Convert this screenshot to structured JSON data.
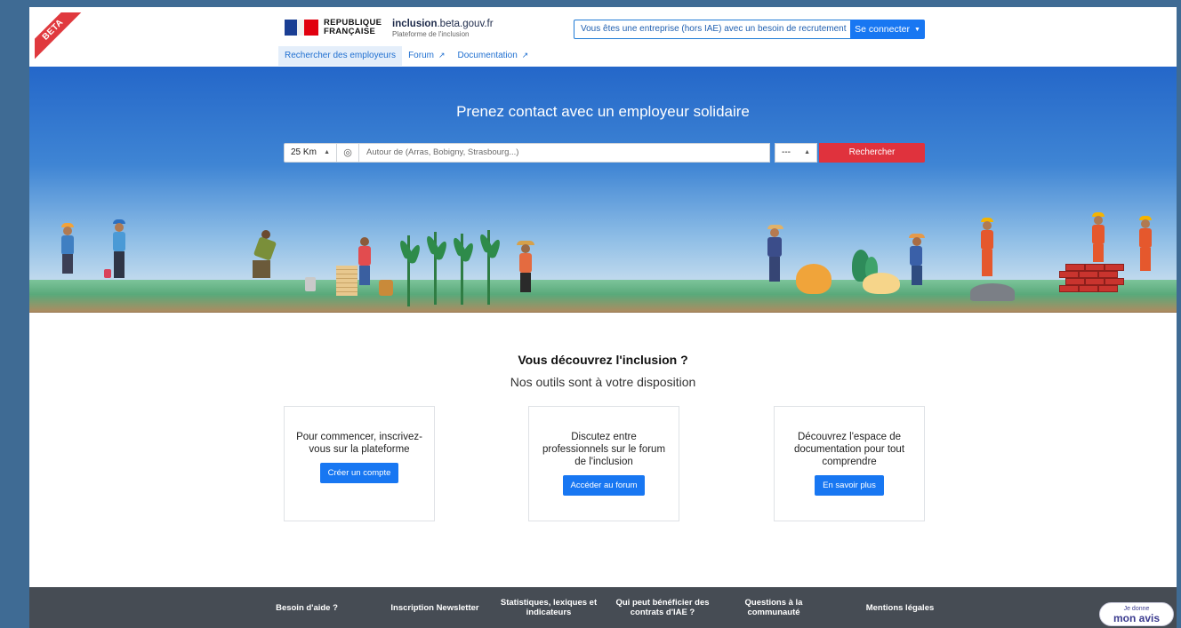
{
  "beta": {
    "label": "BETA"
  },
  "header": {
    "rf_line1": "REPUBLIQUE",
    "rf_line2": "FRANÇAISE",
    "site_title_bold": "inclusion",
    "site_title_rest": ".beta.gouv.fr",
    "site_subtitle": "Plateforme de l'inclusion",
    "entreprise_button": "Vous êtes une entreprise (hors IAE) avec un besoin de recrutement",
    "connect_button": "Se connecter"
  },
  "subnav": {
    "items": [
      {
        "label": "Rechercher des employeurs"
      },
      {
        "label": "Forum"
      },
      {
        "label": "Documentation"
      }
    ]
  },
  "hero": {
    "title": "Prenez contact avec un employeur solidaire",
    "distance_value": "25 Km",
    "location_placeholder": "Autour de (Arras, Bobigny, Strasbourg...)",
    "department_value": "---",
    "search_button": "Rechercher"
  },
  "main": {
    "title": "Vous découvrez l'inclusion ?",
    "subtitle": "Nos outils sont à votre disposition",
    "cards": [
      {
        "text": "Pour commencer, inscrivez-vous sur la plateforme",
        "button": "Créer un compte"
      },
      {
        "text": "Discutez entre professionnels sur le forum de l'inclusion",
        "button": "Accéder au forum"
      },
      {
        "text": "Découvrez l'espace de documentation pour tout comprendre",
        "button": "En savoir plus"
      }
    ]
  },
  "footer": {
    "items": [
      {
        "label": "Besoin d'aide ?"
      },
      {
        "label": "Inscription Newsletter"
      },
      {
        "label": "Statistiques, lexiques et indicateurs"
      },
      {
        "label": "Qui peut bénéficier des contrats d'IAE ?"
      },
      {
        "label": "Questions à la communauté"
      },
      {
        "label": "Mentions légales"
      }
    ]
  },
  "feedback": {
    "line1": "Je donne",
    "line2": "mon avis"
  },
  "colors": {
    "primary": "#1877f2",
    "danger": "#e0323d",
    "footer": "#464c54",
    "frame": "#3f6b94"
  }
}
